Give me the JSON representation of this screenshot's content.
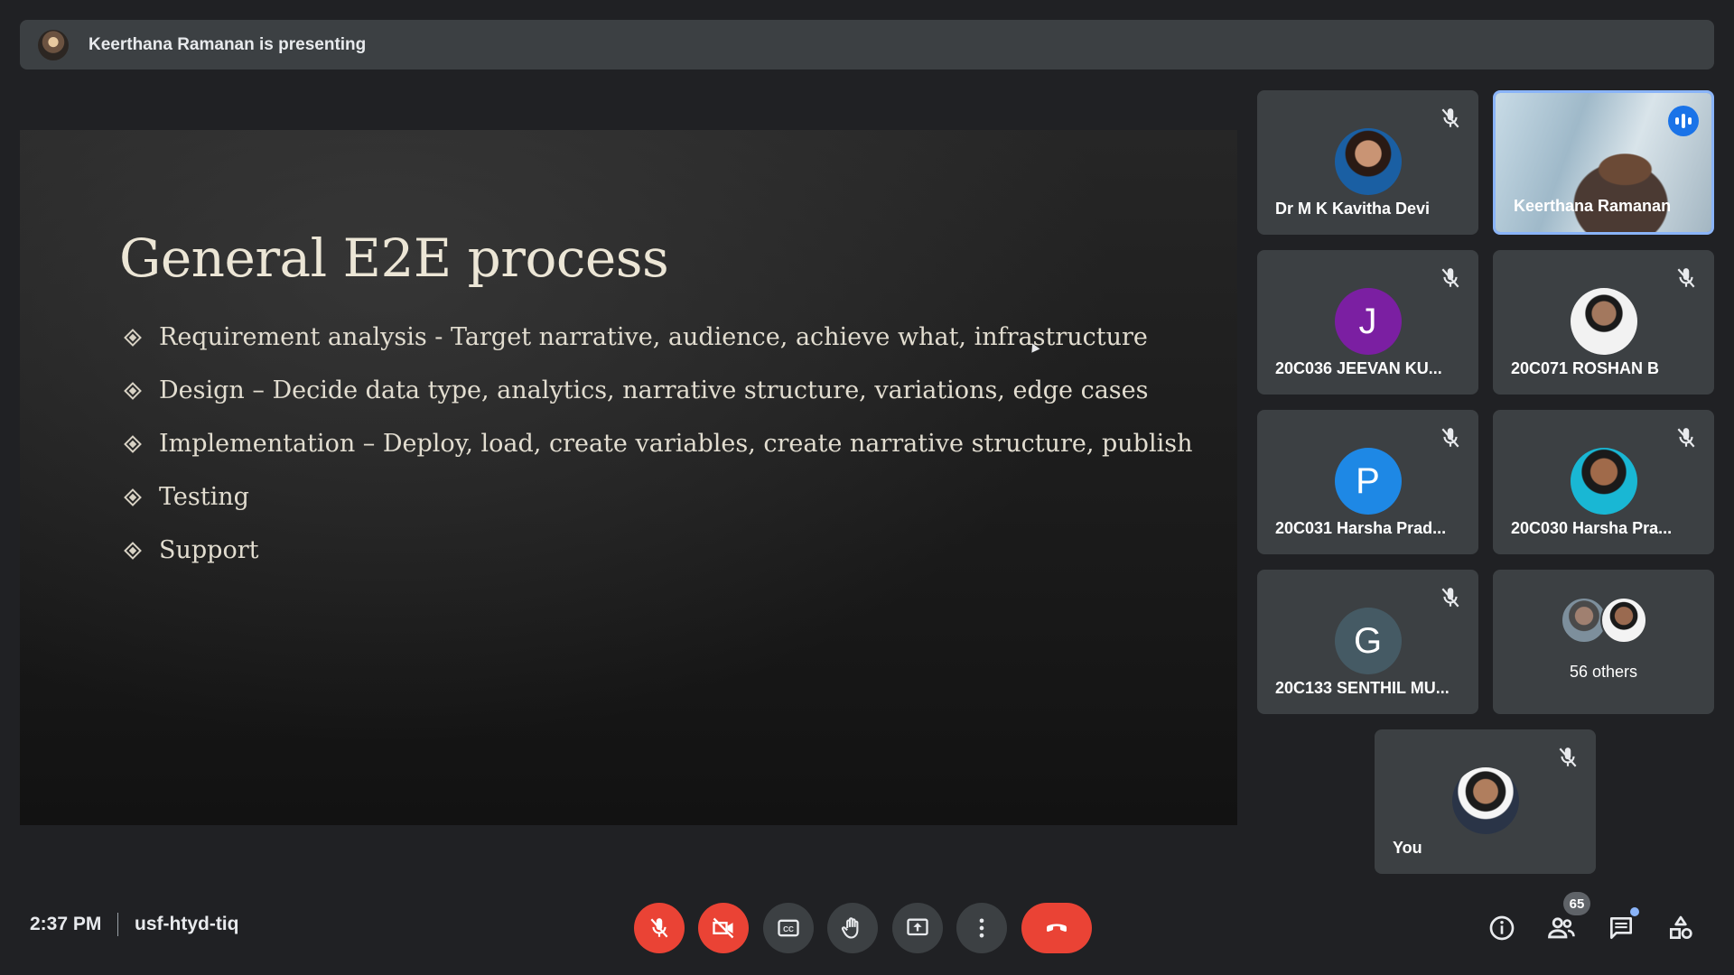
{
  "banner": {
    "text": "Keerthana Ramanan is presenting"
  },
  "slide": {
    "title": "General E2E process",
    "bullets": [
      "Requirement analysis  - Target narrative, audience, achieve what, infrastructure",
      "Design – Decide data type, analytics, narrative structure, variations, edge cases",
      "Implementation – Deploy, load, create variables, create narrative structure, publish",
      "Testing",
      "Support"
    ]
  },
  "participants": [
    {
      "name": "Dr M K Kavitha Devi",
      "muted": true
    },
    {
      "name": "Keerthana Ramanan",
      "speaking": true
    },
    {
      "name": "20C036 JEEVAN KU...",
      "initial": "J",
      "color": "#7b1fa2",
      "muted": true
    },
    {
      "name": "20C071 ROSHAN B",
      "muted": true
    },
    {
      "name": "20C031 Harsha Prad...",
      "initial": "P",
      "color": "#1e88e5",
      "muted": true
    },
    {
      "name": "20C030 Harsha Pra...",
      "muted": true
    },
    {
      "name": "20C133 SENTHIL MU...",
      "initial": "G",
      "color": "#455a64",
      "muted": true
    },
    {
      "name": "56 others"
    },
    {
      "name": "You",
      "muted": true
    }
  ],
  "footer": {
    "time": "2:37 PM",
    "meeting_code": "usf-htyd-tiq",
    "people_count": "65"
  },
  "colors": {
    "accent": "#8ab4f8",
    "danger": "#ea4335",
    "surface": "#3c4043"
  },
  "icons": [
    "mic-off-icon",
    "camera-off-icon",
    "captions-icon",
    "raise-hand-icon",
    "present-icon",
    "more-options-icon",
    "end-call-icon",
    "info-icon",
    "people-icon",
    "chat-icon",
    "activities-icon"
  ]
}
